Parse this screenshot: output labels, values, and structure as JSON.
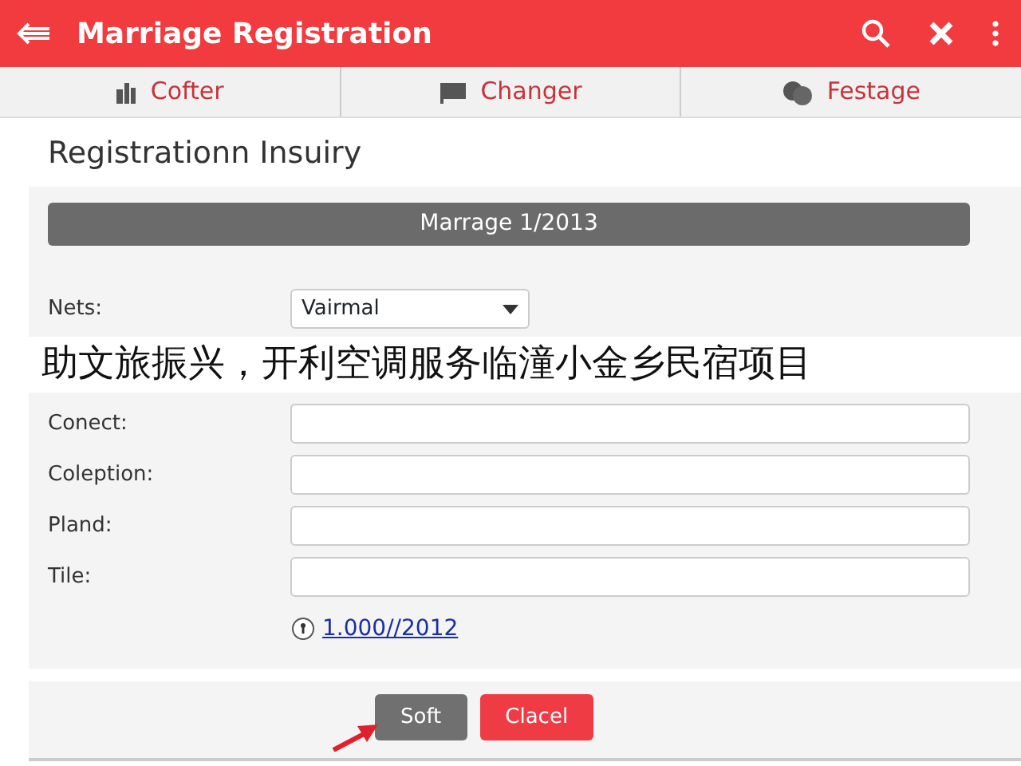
{
  "app_bar": {
    "title": "Marriage Registration"
  },
  "tabs": [
    {
      "label": "Cofter",
      "selected": false
    },
    {
      "label": "Changer",
      "selected": false
    },
    {
      "label": "Festage",
      "selected": false
    }
  ],
  "heading": "Registrationn Insuiry",
  "section_bar": "Marrage 1/2013",
  "form": [
    {
      "label": "Nets:",
      "kind": "select",
      "value": "Vairmal"
    },
    {
      "label": "Conect:",
      "kind": "text"
    },
    {
      "label": "Coleption:",
      "kind": "text"
    },
    {
      "label": "Pland:",
      "kind": "text"
    },
    {
      "label": "Tile:",
      "kind": "text"
    }
  ],
  "info_link": "1.000//2012",
  "buttons": [
    {
      "label": "Soft",
      "kind": "secondary"
    },
    {
      "label": "Clacel",
      "kind": "danger"
    }
  ],
  "caption_banner": "助文旅振兴，开利空调服务临潼小金乡民宿项目"
}
